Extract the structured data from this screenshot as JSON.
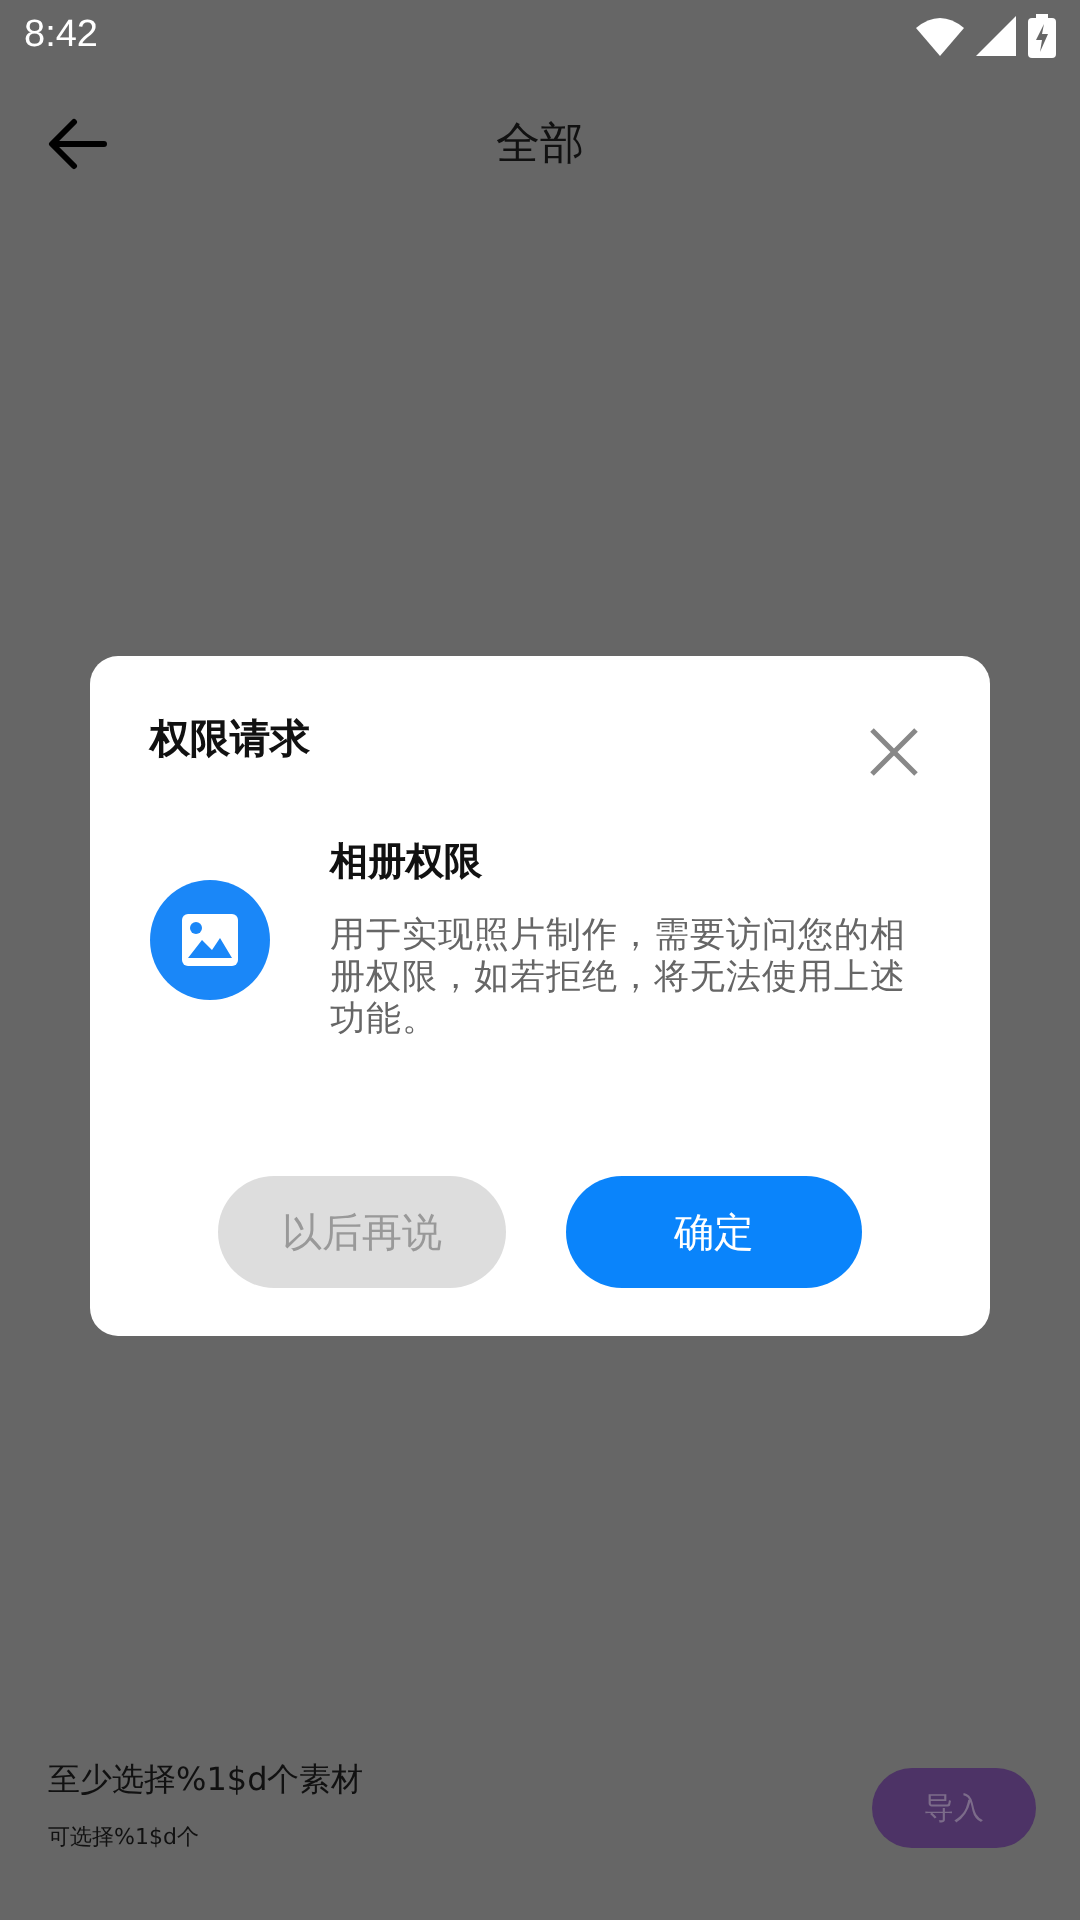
{
  "status_bar": {
    "time": "8:42"
  },
  "toolbar": {
    "title": "全部"
  },
  "footer": {
    "hint": "至少选择%1$d个素材",
    "subhint": "可选择%1$d个",
    "import_button": {
      "label": "导入",
      "disabled": true
    }
  },
  "dialog": {
    "title": "权限请求",
    "permission_title": "相册权限",
    "permission_text": "用于实现照片制作，需要访问您的相册权限，如若拒绝，将无法使用上述功能。",
    "buttons": [
      {
        "label": "以后再说",
        "kind": "secondary"
      },
      {
        "label": "确定",
        "kind": "primary"
      }
    ]
  }
}
